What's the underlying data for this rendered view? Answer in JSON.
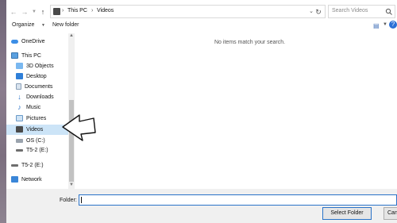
{
  "address": {
    "breadcrumbs": [
      "This PC",
      "Videos"
    ],
    "search_placeholder": "Search Videos"
  },
  "toolbar": {
    "organize_label": "Organize",
    "new_folder_label": "New folder",
    "help_glyph": "?"
  },
  "nav": {
    "onedrive": "OneDrive",
    "this_pc": "This PC",
    "objects_3d": "3D Objects",
    "desktop": "Desktop",
    "documents": "Documents",
    "downloads": "Downloads",
    "music": "Music",
    "pictures": "Pictures",
    "videos": "Videos",
    "os_c": "OS (C:)",
    "t52_e": "T5-2 (E:)",
    "t52_e_root": "T5-2 (E:)",
    "network": "Network"
  },
  "main": {
    "empty_message": "No items match your search."
  },
  "bottom": {
    "folder_label": "Folder:",
    "folder_value": "",
    "select_button": "Select Folder",
    "cancel_button": "Cancel"
  },
  "colors": {
    "selection": "#cce4f7",
    "accent": "#2a73c8"
  },
  "icons": {
    "back": "back-arrow-icon",
    "forward": "forward-arrow-icon",
    "up": "up-arrow-icon",
    "refresh": "refresh-icon",
    "search": "search-icon",
    "view": "view-options-icon",
    "help": "help-icon"
  }
}
